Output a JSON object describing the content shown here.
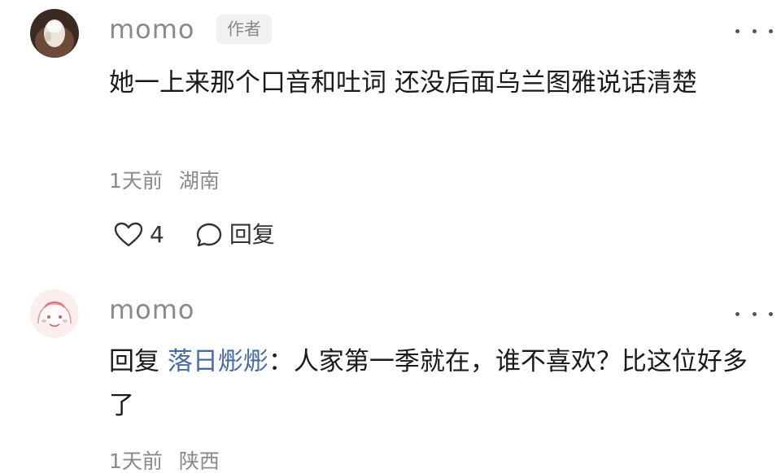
{
  "comments": [
    {
      "username": "momo",
      "badge": "作者",
      "content": "她一上来那个口音和吐词 还没后面乌兰图雅说话清楚",
      "time": "1天前",
      "location": "湖南",
      "likes": "4",
      "reply_label": "回复"
    },
    {
      "username": "momo",
      "reply_prefix": "回复",
      "reply_target": "落日烿烿",
      "content": "：人家第一季就在，谁不喜欢？比这位好多了",
      "time": "1天前",
      "location": "陕西"
    }
  ]
}
